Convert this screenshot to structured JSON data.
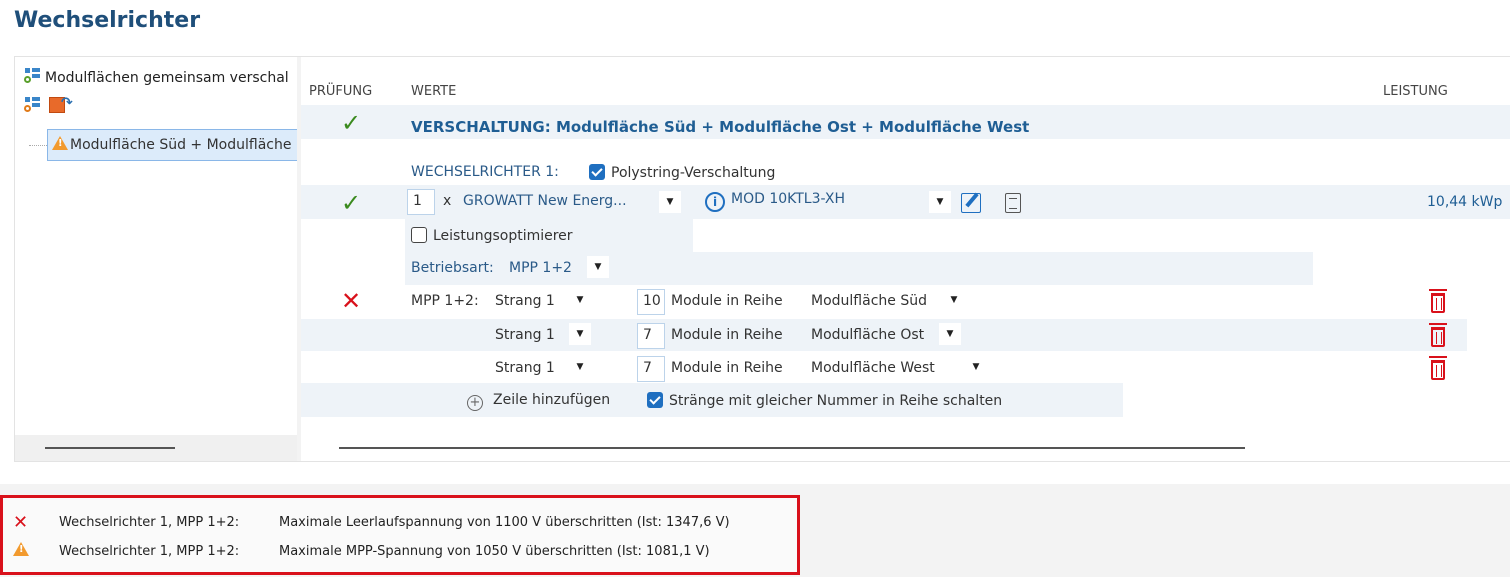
{
  "page_title": "Wechselrichter",
  "tree": {
    "root_label": "Modulflächen gemeinsam verschal",
    "item_label": "Modulfläche Süd + Modulfläche"
  },
  "columns": {
    "pruefung": "PRÜFUNG",
    "werte": "WERTE",
    "leistung": "LEISTUNG"
  },
  "verschaltung_title": "VERSCHALTUNG: Modulfläche Süd + Modulfläche Ost + Modulfläche West",
  "inverter": {
    "label": "WECHSELRICHTER 1:",
    "polystring_label": "Polystring-Verschaltung",
    "polystring_checked": true,
    "count": "1",
    "multiplier": "x",
    "manufacturer": "GROWATT New Energ...",
    "model": "MOD 10KTL3-XH",
    "power": "10,44 kWp",
    "optimizer_label": "Leistungsoptimierer",
    "optimizer_checked": false,
    "mode_label": "Betriebsart:",
    "mode_value": "MPP 1+2"
  },
  "mpp": {
    "label": "MPP 1+2:",
    "rows": [
      {
        "string": "Strang 1",
        "modules": "10",
        "modules_label": "Module in Reihe",
        "area": "Modulfläche Süd"
      },
      {
        "string": "Strang 1",
        "modules": "7",
        "modules_label": "Module in Reihe",
        "area": "Modulfläche Ost"
      },
      {
        "string": "Strang 1",
        "modules": "7",
        "modules_label": "Module in Reihe",
        "area": "Modulfläche West"
      }
    ],
    "add_row_label": "Zeile hinzufügen",
    "series_label": "Stränge mit gleicher Nummer in Reihe schalten",
    "series_checked": true
  },
  "messages": [
    {
      "type": "error",
      "source": "Wechselrichter 1, MPP 1+2:",
      "text": "Maximale Leerlaufspannung von 1100 V überschritten (Ist: 1347,6 V)"
    },
    {
      "type": "warning",
      "source": "Wechselrichter 1, MPP 1+2:",
      "text": "Maximale MPP-Spannung von 1050 V überschritten (Ist: 1081,1 V)"
    }
  ],
  "colors": {
    "title": "#1f4f7a",
    "accent": "#1f6fc0",
    "ok": "#3a8a1e",
    "error": "#d9111b",
    "warning": "#f29a2e"
  }
}
